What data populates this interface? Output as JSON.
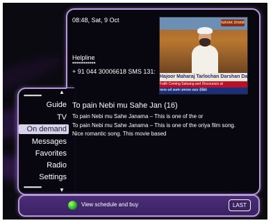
{
  "status": {
    "datetime": "08:48, Sat, 9 Oct"
  },
  "helpline": {
    "label": "Helpline",
    "number": "+ 91 044 30006618 SMS 131:"
  },
  "preview": {
    "channel_logo": "NAVAK DHAM",
    "banner": "Hajoor Maharaj Tarlochan Darshan Das Ji",
    "ticker": "Faith Coming Satsang and Discourses at",
    "ticker2": "मानव धर्म सत्संग समाचार सदन देखिये"
  },
  "menu": {
    "items": [
      {
        "label": "Guide",
        "selected": false
      },
      {
        "label": "TV",
        "selected": false
      },
      {
        "label": "On demand",
        "selected": true
      },
      {
        "label": "Messages",
        "selected": false
      },
      {
        "label": "Favorites",
        "selected": false
      },
      {
        "label": "Radio",
        "selected": false
      },
      {
        "label": "Settings",
        "selected": false
      }
    ],
    "up_arrow": "▲",
    "down_arrow": "▼"
  },
  "program": {
    "title": "To pain Nebi mu Sahe Jan (16)",
    "description_lines": [
      "To pain Nebi mu Sahe Janama – This is one of the or",
      "To pain Nebi mu Sahe Janama – This is one of the oriya film song.",
      "Nice romantic song. This movie based"
    ]
  },
  "footer": {
    "green_action": "View schedule and buy",
    "last_button": "LAST"
  },
  "colors": {
    "accent_border": "#b79bd8",
    "footer_bg": "#3a2264",
    "selected_bg": "#d9d3ea",
    "green_button": "#2eb82a"
  },
  "icons": {
    "green_button": "green-circle-icon",
    "scroll_up": "triangle-up-icon",
    "scroll_down": "triangle-down-icon"
  }
}
